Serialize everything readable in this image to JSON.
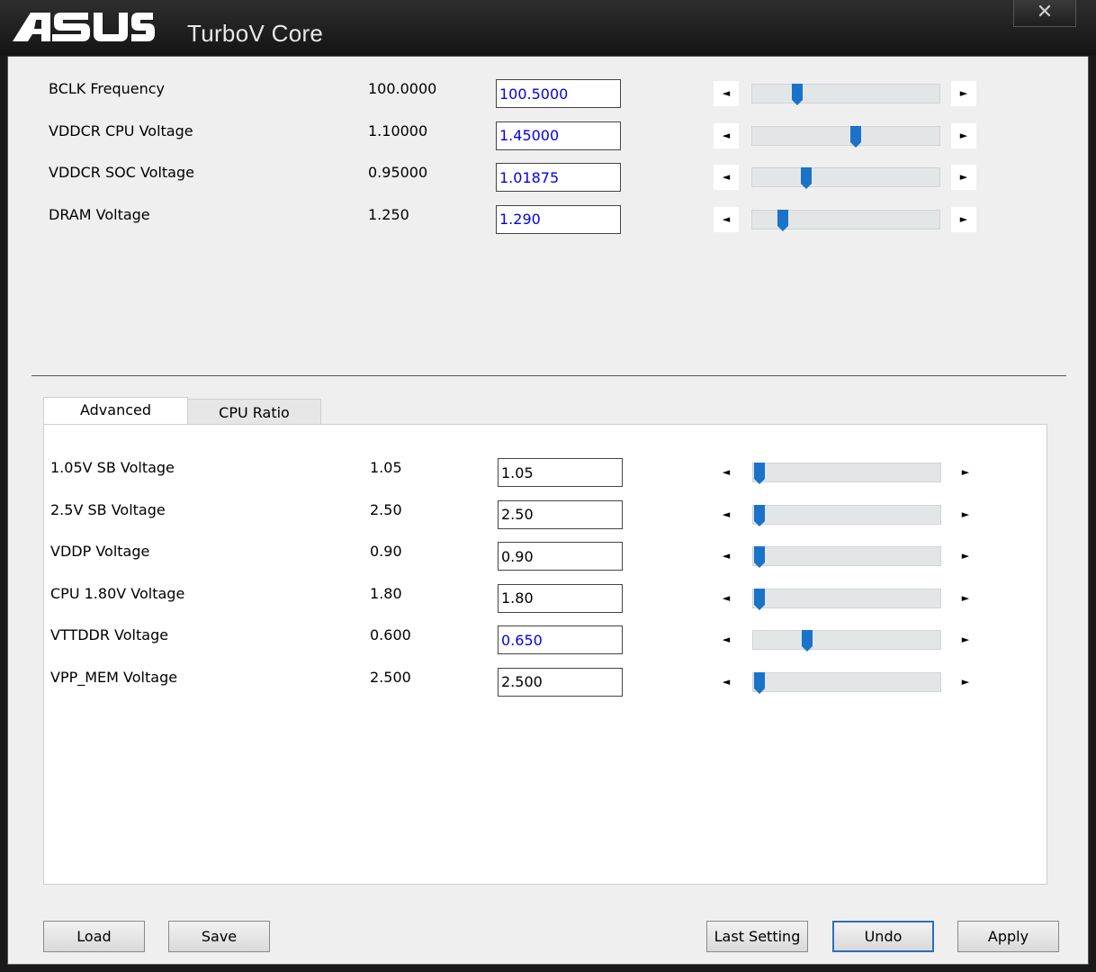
{
  "window": {
    "brand": "ASUS",
    "title": "TurboV Core",
    "close_label": "✕"
  },
  "main_settings": [
    {
      "label": "BCLK Frequency",
      "current": "100.0000",
      "value": "100.5000",
      "changed": true,
      "level": 0.22
    },
    {
      "label": "VDDCR CPU Voltage",
      "current": "1.10000",
      "value": "1.45000",
      "changed": true,
      "level": 0.55
    },
    {
      "label": "VDDCR SOC Voltage",
      "current": "0.95000",
      "value": "1.01875",
      "changed": true,
      "level": 0.27
    },
    {
      "label": "DRAM Voltage",
      "current": "1.250",
      "value": "1.290",
      "changed": true,
      "level": 0.14
    }
  ],
  "tabs": [
    {
      "label": "Advanced",
      "active": true
    },
    {
      "label": "CPU Ratio",
      "active": false
    }
  ],
  "advanced_settings": [
    {
      "label": "1.05V SB Voltage",
      "current": "1.05",
      "value": "1.05",
      "changed": false,
      "level": 0.0
    },
    {
      "label": "2.5V SB Voltage",
      "current": "2.50",
      "value": "2.50",
      "changed": false,
      "level": 0.0
    },
    {
      "label": "VDDP Voltage",
      "current": "0.90",
      "value": "0.90",
      "changed": false,
      "level": 0.0
    },
    {
      "label": "CPU 1.80V Voltage",
      "current": "1.80",
      "value": "1.80",
      "changed": false,
      "level": 0.0
    },
    {
      "label": "VTTDDR Voltage",
      "current": "0.600",
      "value": "0.650",
      "changed": true,
      "level": 0.27
    },
    {
      "label": "VPP_MEM Voltage",
      "current": "2.500",
      "value": "2.500",
      "changed": false,
      "level": 0.0
    }
  ],
  "icons": {
    "left_arrow": "left-arrow-icon",
    "right_arrow": "right-arrow-icon",
    "decrease_glyph": "◄",
    "increase_glyph": "►"
  },
  "colors": {
    "accent": "#1a73c8",
    "changed_text": "#0000ee",
    "titlebar": "#1e1e1e"
  },
  "buttons": {
    "load": "Load",
    "save": "Save",
    "last_setting": "Last Setting",
    "undo": "Undo",
    "apply": "Apply"
  }
}
